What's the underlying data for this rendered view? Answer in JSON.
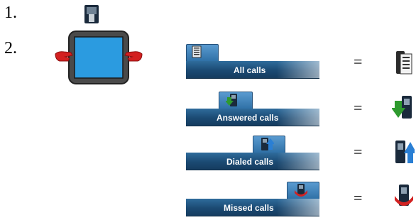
{
  "steps": {
    "step1": "1.",
    "step2": "2."
  },
  "tabs": [
    {
      "label": "All calls",
      "icon": "call-log-list-icon"
    },
    {
      "label": "Answered calls",
      "icon": "answered-call-green-arrow-icon"
    },
    {
      "label": "Dialed calls",
      "icon": "dialed-call-blue-arrow-icon"
    },
    {
      "label": "Missed calls",
      "icon": "missed-call-red-arrow-icon"
    }
  ],
  "equals": "=",
  "colors": {
    "tab": "#1b4a73",
    "answered": "#2e9a2e",
    "dialed": "#2a7fd4",
    "missed": "#d22222",
    "screen": "#2b9be0"
  }
}
